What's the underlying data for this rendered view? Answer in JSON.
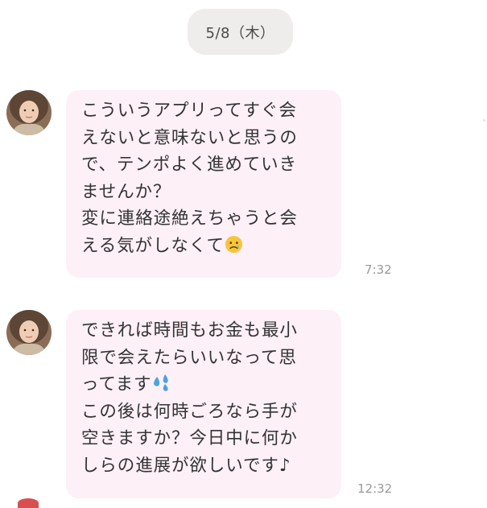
{
  "date_separator": "5/8（木）",
  "messages": [
    {
      "sender": "other",
      "avatar_icon": "user-avatar-photo",
      "lines": [
        "こういうアプリってすぐ会",
        "えないと意味ないと思うの",
        "で、テンポよく進めていき",
        "ませんか？",
        "変に連絡途絶えちゃうと会",
        "える気がしなくて"
      ],
      "trailing_emoji": "sad-face-emoji",
      "time": "7:32"
    },
    {
      "sender": "other",
      "avatar_icon": "user-avatar-photo",
      "lines": [
        "できれば時間もお金も最小",
        "限で会えたらいいなって思",
        "ってます",
        "この後は何時ごろなら手が",
        "空きますか？今日中に何か",
        "しらの進展が欲しいです♪"
      ],
      "inline_emoji": "sweat-droplets-emoji",
      "time": "12:32"
    }
  ],
  "colors": {
    "bubble_background": "#fdf0f6",
    "date_pill_background": "#efecec",
    "text": "#333333",
    "timestamp": "#9a9a9a"
  }
}
